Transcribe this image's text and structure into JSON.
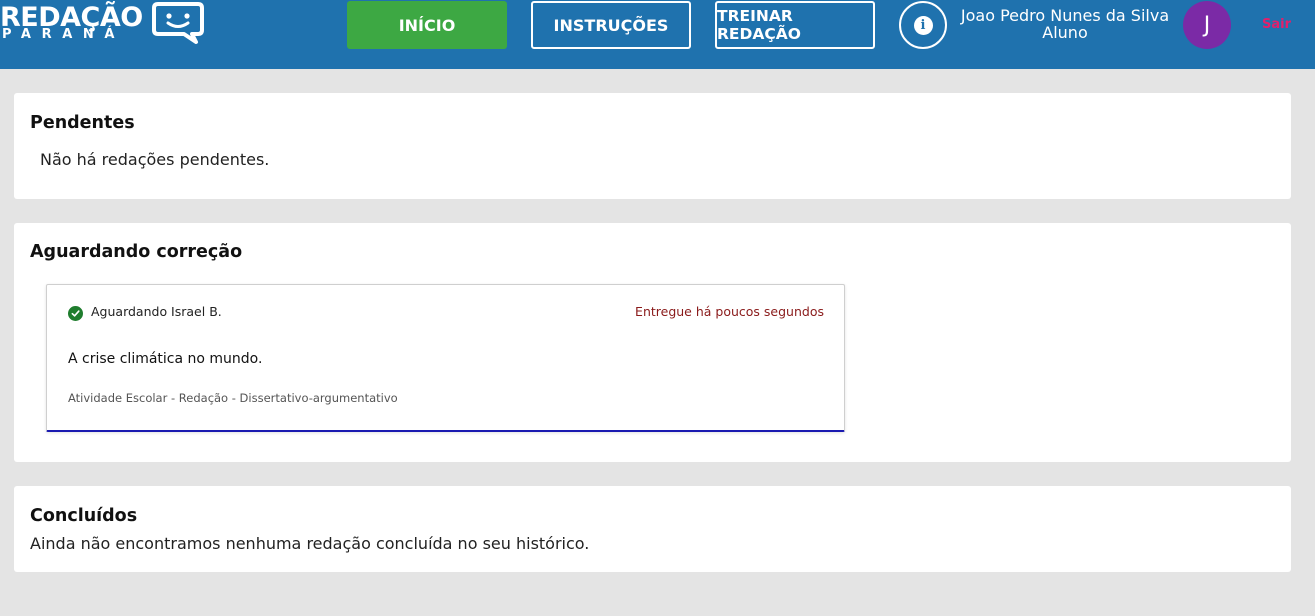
{
  "brand": {
    "title": "REDAÇÃO",
    "subtitle": "PARANÁ"
  },
  "nav": {
    "home_label": "INÍCIO",
    "instructions_label": "INSTRUÇÕES",
    "practice_label": "TREINAR REDAÇÃO"
  },
  "user": {
    "name": "Joao Pedro Nunes da Silva",
    "role": "Aluno",
    "initial": "J",
    "logout_label": "Sair"
  },
  "sections": {
    "pending": {
      "title": "Pendentes",
      "empty_text": "Não há redações pendentes."
    },
    "awaiting": {
      "title": "Aguardando correção",
      "essay": {
        "status": "Aguardando Israel B.",
        "delivered": "Entregue há poucos segundos",
        "title": "A crise climática no mundo.",
        "meta": "Atividade Escolar - Redação - Dissertativo-argumentativo"
      }
    },
    "completed": {
      "title": "Concluídos",
      "empty_text": "Ainda não encontramos nenhuma redação concluída no seu histórico."
    }
  },
  "colors": {
    "header": "#1f72ae",
    "home_button": "#3da843",
    "avatar": "#7b2aa6",
    "logout": "#e21f6b",
    "essay_underline": "#1a1ab0"
  },
  "icons": {
    "info": "info-icon",
    "check": "check-circle-icon",
    "logo_bubble": "smile-speech-bubble-icon"
  }
}
